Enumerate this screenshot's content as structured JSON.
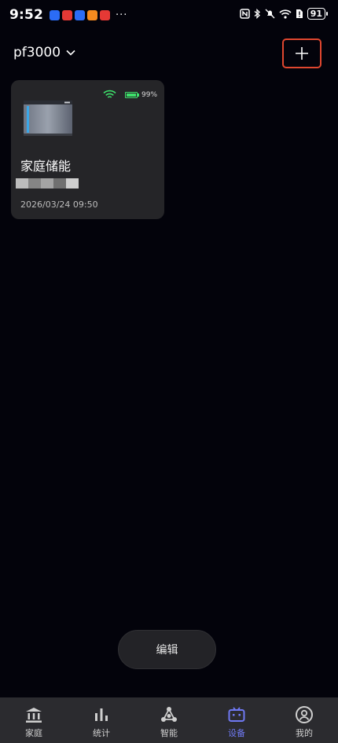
{
  "status_bar": {
    "time": "9:52",
    "notifications": [
      {
        "icon": "app-notification-icon",
        "color": "#2b6cf6"
      },
      {
        "icon": "app-notification-icon",
        "color": "#e53935"
      },
      {
        "icon": "app-notification-icon",
        "color": "#2b6cf6"
      },
      {
        "icon": "app-notification-icon",
        "color": "#f58a1f"
      },
      {
        "icon": "app-notification-icon",
        "color": "#e53935"
      }
    ],
    "more": "···",
    "battery_level": "91"
  },
  "header": {
    "home_name": "pf3000",
    "add_icon": "plus-icon",
    "highlight_color": "#e0472f"
  },
  "device": {
    "name": "家庭储能",
    "battery_percent": "99%",
    "battery_fraction": 0.99,
    "timestamp": "2026/03/24 09:50",
    "wifi_color": "#3ee06b"
  },
  "edit_button": {
    "label": "编辑"
  },
  "bottom_nav": {
    "active_color": "#6f79f3",
    "items": [
      {
        "label": "家庭",
        "icon": "home-bank-icon"
      },
      {
        "label": "统计",
        "icon": "bar-chart-icon"
      },
      {
        "label": "智能",
        "icon": "network-icon"
      },
      {
        "label": "设备",
        "icon": "device-icon",
        "active": true
      },
      {
        "label": "我的",
        "icon": "user-icon"
      }
    ]
  }
}
